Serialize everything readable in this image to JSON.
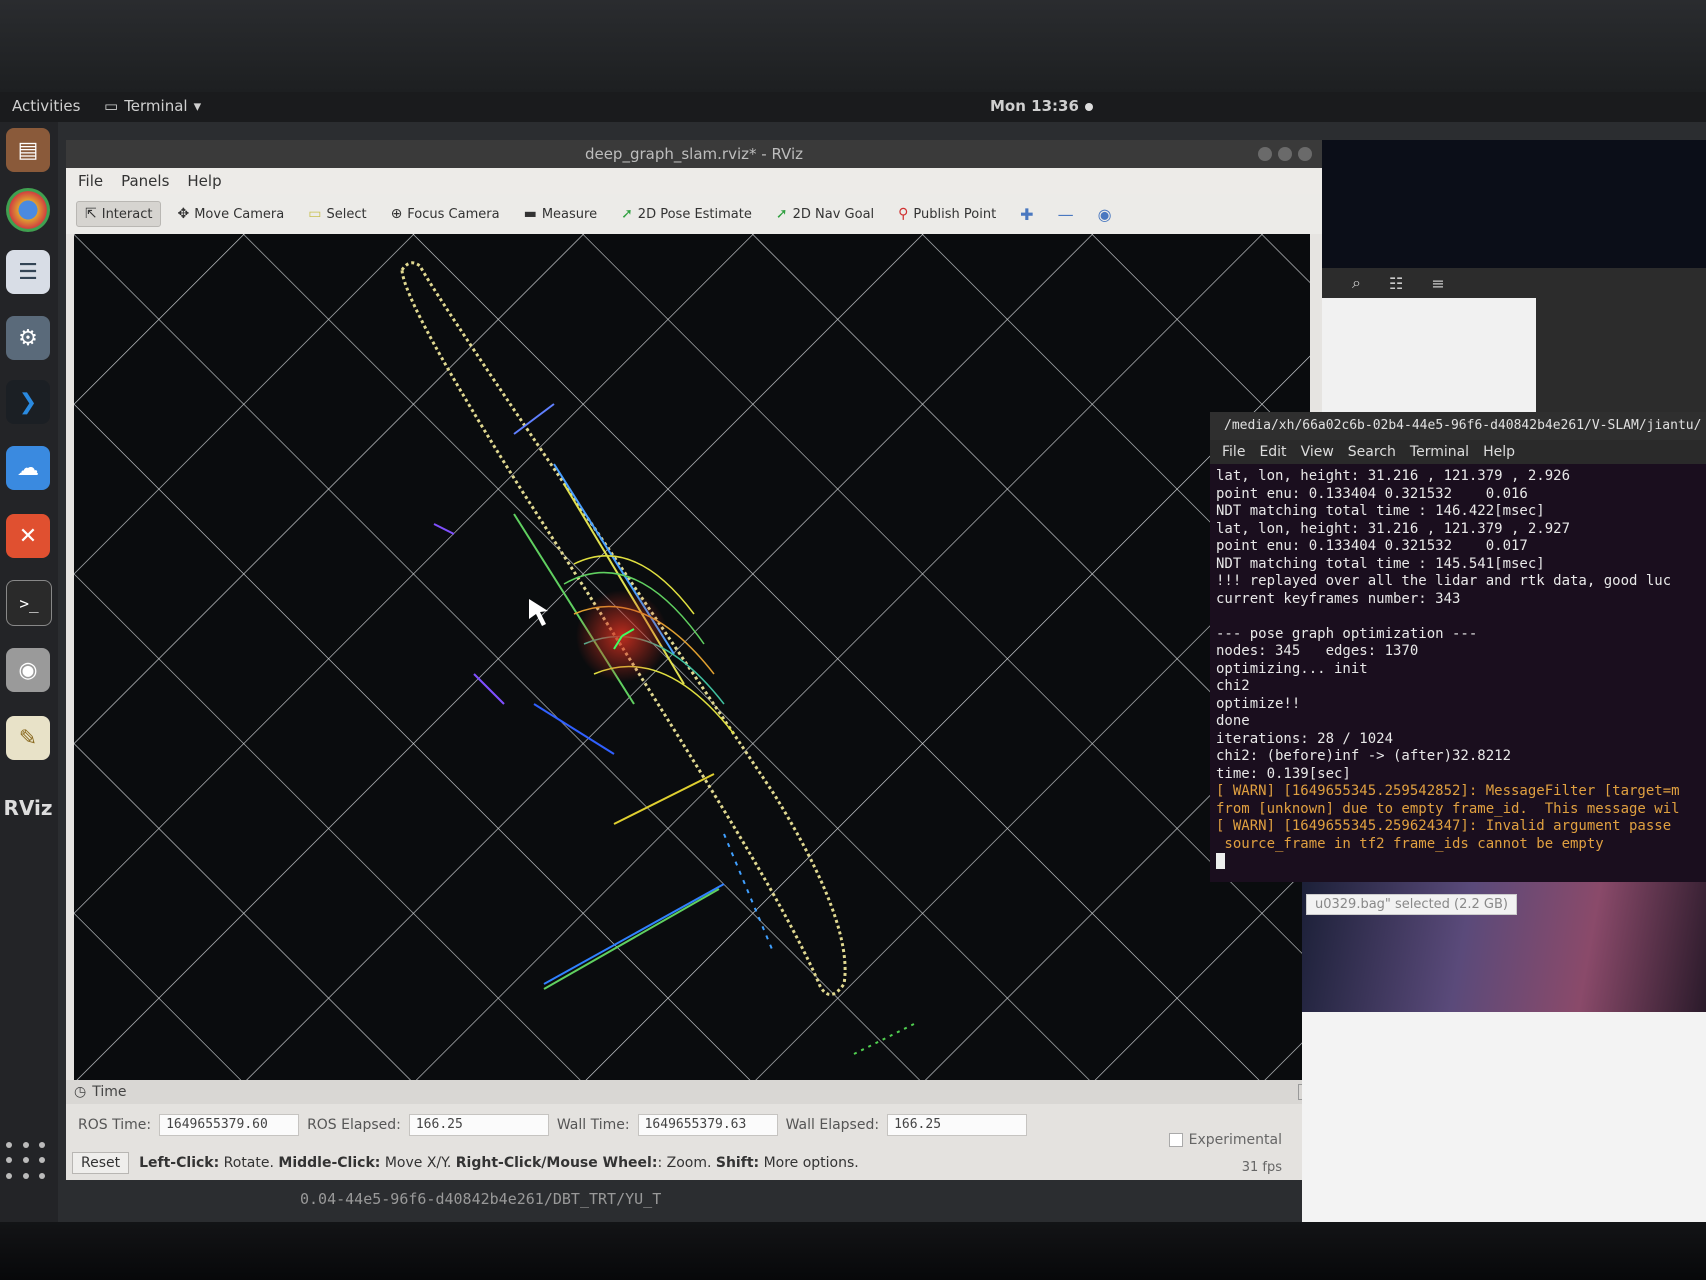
{
  "topbar": {
    "activities": "Activities",
    "app_menu": "Terminal",
    "clock": "Mon 13:36"
  },
  "rviz": {
    "title": "deep_graph_slam.rviz* - RViz",
    "menu": [
      "File",
      "Panels",
      "Help"
    ],
    "tools": [
      {
        "label": "Interact",
        "icon": "cursor-icon"
      },
      {
        "label": "Move Camera",
        "icon": "move-icon"
      },
      {
        "label": "Select",
        "icon": "select-icon"
      },
      {
        "label": "Focus Camera",
        "icon": "focus-icon"
      },
      {
        "label": "Measure",
        "icon": "ruler-icon"
      },
      {
        "label": "2D Pose Estimate",
        "icon": "arrow-icon"
      },
      {
        "label": "2D Nav Goal",
        "icon": "arrow-icon"
      },
      {
        "label": "Publish Point",
        "icon": "pin-icon"
      }
    ],
    "time_panel": {
      "title": "Time",
      "ros_time_label": "ROS Time:",
      "ros_time": "1649655379.60",
      "ros_elapsed_label": "ROS Elapsed:",
      "ros_elapsed": "166.25",
      "wall_time_label": "Wall Time:",
      "wall_time": "1649655379.63",
      "wall_elapsed_label": "Wall Elapsed:",
      "wall_elapsed": "166.25",
      "experimental": "Experimental",
      "reset": "Reset",
      "hint_left_click": "Left-Click:",
      "hint_rotate": "Rotate.",
      "hint_middle_click": "Middle-Click:",
      "hint_move": "Move X/Y.",
      "hint_right_click": "Right-Click/Mouse Wheel:",
      "hint_zoom": ": Zoom.",
      "hint_shift": "Shift:",
      "hint_more": "More options.",
      "fps": "31 fps"
    }
  },
  "terminal": {
    "title": "/media/xh/66a02c6b-02b4-44e5-96f6-d40842b4e261/V-SLAM/jiantu/",
    "menu": [
      "File",
      "Edit",
      "View",
      "Search",
      "Terminal",
      "Help"
    ],
    "lines": [
      {
        "text": "lat, lon, height: 31.216 , 121.379 , 2.926",
        "warn": false
      },
      {
        "text": "point enu: 0.133404 0.321532    0.016",
        "warn": false
      },
      {
        "text": "NDT matching total time : 146.422[msec]",
        "warn": false
      },
      {
        "text": "lat, lon, height: 31.216 , 121.379 , 2.927",
        "warn": false
      },
      {
        "text": "point enu: 0.133404 0.321532    0.017",
        "warn": false
      },
      {
        "text": "NDT matching total time : 145.541[msec]",
        "warn": false
      },
      {
        "text": "!!! replayed over all the lidar and rtk data, good luc",
        "warn": false
      },
      {
        "text": "current keyframes number: 343",
        "warn": false
      },
      {
        "text": "",
        "warn": false
      },
      {
        "text": "--- pose graph optimization ---",
        "warn": false
      },
      {
        "text": "nodes: 345   edges: 1370",
        "warn": false
      },
      {
        "text": "optimizing... init",
        "warn": false
      },
      {
        "text": "chi2",
        "warn": false
      },
      {
        "text": "optimize!!",
        "warn": false
      },
      {
        "text": "done",
        "warn": false
      },
      {
        "text": "iterations: 28 / 1024",
        "warn": false
      },
      {
        "text": "chi2: (before)inf -> (after)32.8212",
        "warn": false
      },
      {
        "text": "time: 0.139[sec]",
        "warn": false
      },
      {
        "text": "[ WARN] [1649655345.259542852]: MessageFilter [target=m",
        "warn": true
      },
      {
        "text": "from [unknown] due to empty frame_id.  This message wil",
        "warn": true
      },
      {
        "text": "[ WARN] [1649655345.259624347]: Invalid argument passe",
        "warn": true
      },
      {
        "text": " source_frame in tf2 frame_ids cannot be empty",
        "warn": true
      }
    ]
  },
  "file_selection": "u0329.bag\" selected (2.2 GB)",
  "bottom_text": "0.04-44e5-96f6-d40842b4e261/DBT_TRT/YU_T"
}
